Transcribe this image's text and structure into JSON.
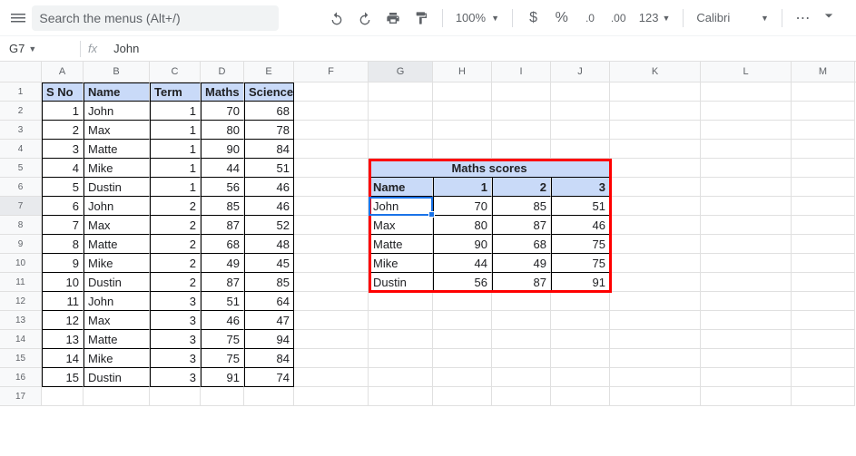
{
  "toolbar": {
    "search_placeholder": "Search the menus (Alt+/)",
    "zoom": "100%",
    "font": "Calibri",
    "fmt_dollar": "$",
    "fmt_percent": "%",
    "fmt_dec_dec": ".0",
    "fmt_dec_inc": ".00",
    "fmt_123": "123"
  },
  "namebox": {
    "cell": "G7",
    "fx": "fx",
    "value": "John"
  },
  "columns": [
    "A",
    "B",
    "C",
    "D",
    "E",
    "F",
    "G",
    "H",
    "I",
    "J",
    "K",
    "L",
    "M"
  ],
  "active_col": "G",
  "active_row": 7,
  "main_headers": {
    "sno": "S No",
    "name": "Name",
    "term": "Term",
    "maths": "Maths",
    "science": "Science"
  },
  "main_rows": [
    {
      "sno": 1,
      "name": "John",
      "term": 1,
      "maths": 70,
      "science": 68
    },
    {
      "sno": 2,
      "name": "Max",
      "term": 1,
      "maths": 80,
      "science": 78
    },
    {
      "sno": 3,
      "name": "Matte",
      "term": 1,
      "maths": 90,
      "science": 84
    },
    {
      "sno": 4,
      "name": "Mike",
      "term": 1,
      "maths": 44,
      "science": 51
    },
    {
      "sno": 5,
      "name": "Dustin",
      "term": 1,
      "maths": 56,
      "science": 46
    },
    {
      "sno": 6,
      "name": "John",
      "term": 2,
      "maths": 85,
      "science": 46
    },
    {
      "sno": 7,
      "name": "Max",
      "term": 2,
      "maths": 87,
      "science": 52
    },
    {
      "sno": 8,
      "name": "Matte",
      "term": 2,
      "maths": 68,
      "science": 48
    },
    {
      "sno": 9,
      "name": "Mike",
      "term": 2,
      "maths": 49,
      "science": 45
    },
    {
      "sno": 10,
      "name": "Dustin",
      "term": 2,
      "maths": 87,
      "science": 85
    },
    {
      "sno": 11,
      "name": "John",
      "term": 3,
      "maths": 51,
      "science": 64
    },
    {
      "sno": 12,
      "name": "Max",
      "term": 3,
      "maths": 46,
      "science": 47
    },
    {
      "sno": 13,
      "name": "Matte",
      "term": 3,
      "maths": 75,
      "science": 94
    },
    {
      "sno": 14,
      "name": "Mike",
      "term": 3,
      "maths": 75,
      "science": 84
    },
    {
      "sno": 15,
      "name": "Dustin",
      "term": 3,
      "maths": 91,
      "science": 74
    }
  ],
  "chart_data": {
    "type": "table",
    "title": "Maths scores",
    "headers": {
      "name": "Name",
      "c1": "1",
      "c2": "2",
      "c3": "3"
    },
    "rows": [
      {
        "name": "John",
        "c1": 70,
        "c2": 85,
        "c3": 51
      },
      {
        "name": "Max",
        "c1": 80,
        "c2": 87,
        "c3": 46
      },
      {
        "name": "Matte",
        "c1": 90,
        "c2": 68,
        "c3": 75
      },
      {
        "name": "Mike",
        "c1": 44,
        "c2": 49,
        "c3": 75
      },
      {
        "name": "Dustin",
        "c1": 56,
        "c2": 87,
        "c3": 91
      }
    ]
  }
}
